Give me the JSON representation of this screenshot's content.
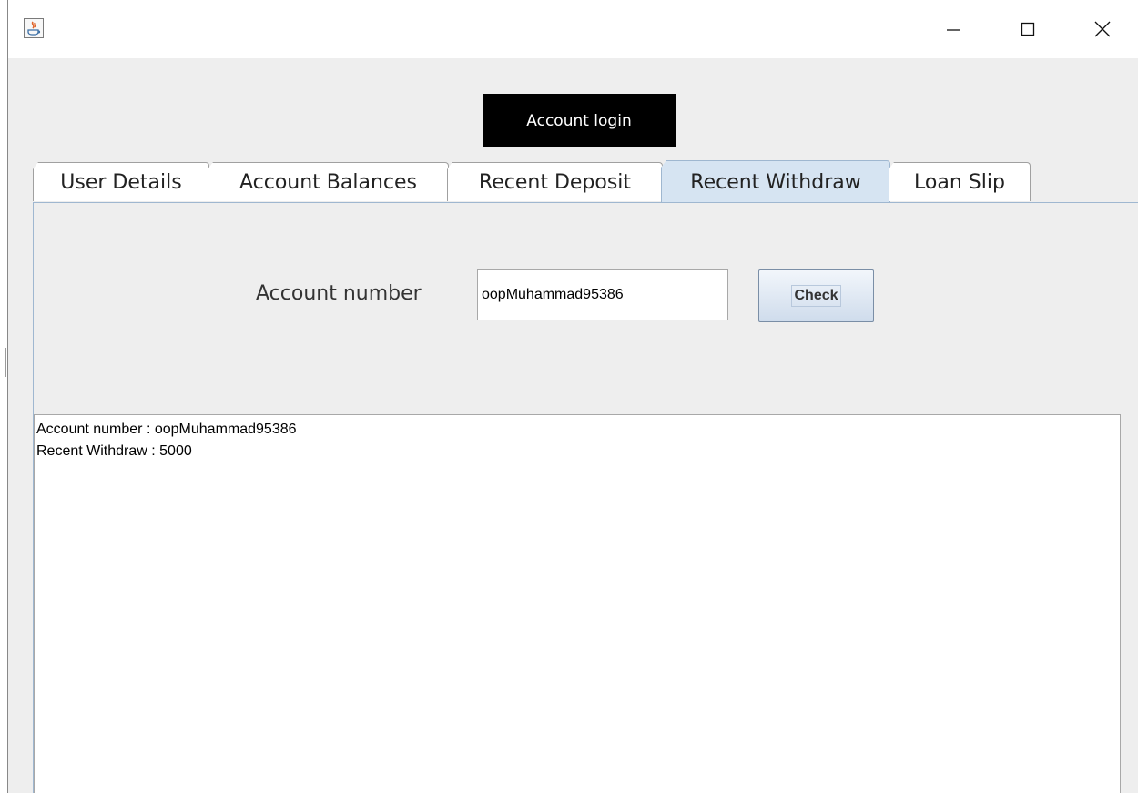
{
  "window": {
    "title": "",
    "controls": {
      "minimize": "—",
      "maximize": "☐",
      "close": "✕"
    }
  },
  "header": {
    "login_label": "Account login"
  },
  "tabs": [
    {
      "label": "User Details"
    },
    {
      "label": "Account Balances"
    },
    {
      "label": "Recent Deposit"
    },
    {
      "label": "Recent Withdraw"
    },
    {
      "label": "Loan Slip"
    }
  ],
  "active_tab": "Recent Withdraw",
  "form": {
    "account_label": "Account number",
    "account_value": "oopMuhammad95386",
    "check_label": "Check"
  },
  "output": {
    "lines": [
      "Account number : oopMuhammad95386",
      "Recent Withdraw : 5000"
    ]
  },
  "colors": {
    "active_tab": "#d6e4f2",
    "login_button": "#000000",
    "panel_border": "#9fb7d0"
  }
}
